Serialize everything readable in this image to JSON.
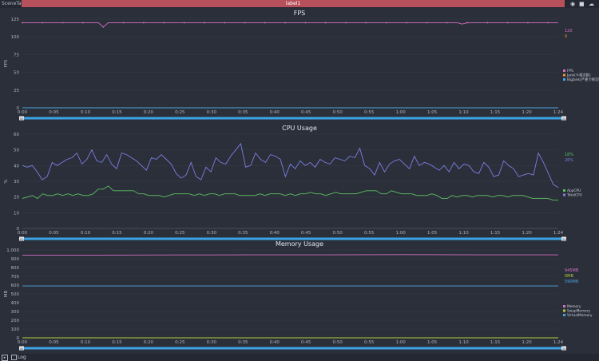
{
  "tab": {
    "scene": "SceneTab",
    "label": "label1"
  },
  "icons": [
    "location-icon",
    "folder-icon",
    "cloud-icon"
  ],
  "status": {
    "log_label": "Log"
  },
  "chart_data": [
    {
      "type": "line",
      "title": "FPS",
      "ylabel": "FPS",
      "ylim": [
        0,
        125
      ],
      "yticks": [
        "0",
        "25",
        "50",
        "75",
        "100",
        "125"
      ],
      "xticks": [
        "0:00",
        "0:05",
        "0:10",
        "0:15",
        "0:20",
        "0:25",
        "0:30",
        "0:35",
        "0:40",
        "0:45",
        "0:50",
        "0:55",
        "1:00",
        "1:05",
        "1:10",
        "1:15",
        "1:20",
        "1:24"
      ],
      "slider": {
        "start": "00",
        "end": "24"
      },
      "current": [
        {
          "text": "120",
          "color": "#d46fc6"
        },
        {
          "text": "0",
          "color": "#e9943a"
        }
      ],
      "series": [
        {
          "name": "FPS",
          "color": "#d46fc6",
          "markers": true,
          "values": [
            120,
            120,
            120,
            120,
            120,
            120,
            120,
            120,
            120,
            120,
            120,
            120,
            120,
            120,
            120,
            120,
            114,
            120,
            120,
            120,
            120,
            120,
            120,
            120,
            120,
            120,
            120,
            120,
            120,
            120,
            120,
            120,
            120,
            120,
            120,
            120,
            120,
            120,
            120,
            120,
            120,
            120,
            120,
            120,
            120,
            120,
            120,
            120,
            120,
            120,
            120,
            120,
            120,
            120,
            120,
            120,
            120,
            120,
            120,
            120,
            120,
            120,
            120,
            120,
            120,
            120,
            120,
            120,
            120,
            120,
            120,
            120,
            120,
            120,
            120,
            120,
            120,
            120,
            120,
            120,
            120,
            120,
            120,
            120,
            120,
            120,
            120,
            118,
            120,
            120,
            120,
            120,
            120,
            120,
            120,
            120,
            120,
            120,
            120,
            120,
            120,
            120,
            120,
            120,
            120,
            120,
            120
          ]
        },
        {
          "name": "Jank(卡顿次数)",
          "color": "#e9943a",
          "markers": false,
          "values": [
            0,
            0
          ]
        },
        {
          "name": "BigJank(严重卡顿次数)",
          "color": "#4aa3df",
          "markers": false,
          "values": [
            0,
            0
          ]
        }
      ]
    },
    {
      "type": "line",
      "title": "CPU Usage",
      "ylabel": "%",
      "ylim": [
        0,
        60
      ],
      "yticks": [
        "0",
        "10",
        "20",
        "30",
        "40",
        "50",
        "60"
      ],
      "xticks": [
        "0:00",
        "0:05",
        "0:10",
        "0:15",
        "0:20",
        "0:25",
        "0:30",
        "0:35",
        "0:40",
        "0:45",
        "0:50",
        "0:55",
        "1:00",
        "1:05",
        "1:10",
        "1:15",
        "1:20",
        "1:24"
      ],
      "slider": {
        "start": "00",
        "end": "24"
      },
      "current": [
        {
          "text": "18%",
          "color": "#5cbf60"
        },
        {
          "text": "26%",
          "color": "#7a7fe0"
        }
      ],
      "series": [
        {
          "name": "AppCPU",
          "color": "#5cbf60",
          "markers": false,
          "values": [
            19,
            20,
            21,
            19,
            22,
            21,
            21,
            22,
            21,
            22,
            21,
            22,
            21,
            21,
            22,
            25,
            25,
            27,
            24,
            24,
            24,
            24,
            24,
            22,
            22,
            21,
            21,
            21,
            20,
            21,
            22,
            22,
            22,
            22,
            21,
            22,
            21,
            22,
            22,
            21,
            22,
            22,
            22,
            21,
            21,
            21,
            21,
            22,
            21,
            22,
            22,
            22,
            21,
            22,
            21,
            22,
            22,
            23,
            22,
            22,
            21,
            22,
            23,
            22,
            22,
            22,
            22,
            23,
            24,
            24,
            24,
            22,
            22,
            24,
            23,
            22,
            22,
            22,
            21,
            21,
            21,
            22,
            21,
            19,
            19,
            21,
            20,
            21,
            21,
            20,
            21,
            21,
            21,
            20,
            21,
            21,
            20,
            21,
            21,
            21,
            20,
            19,
            19,
            19,
            19,
            18,
            18
          ]
        },
        {
          "name": "TotalCPU",
          "color": "#7a7fe0",
          "markers": false,
          "values": [
            40,
            39,
            40,
            36,
            31,
            33,
            42,
            40,
            42,
            44,
            45,
            48,
            41,
            44,
            50,
            43,
            42,
            47,
            41,
            38,
            48,
            47,
            45,
            43,
            40,
            37,
            45,
            44,
            47,
            44,
            41,
            35,
            32,
            34,
            42,
            33,
            31,
            39,
            36,
            45,
            42,
            41,
            46,
            50,
            54,
            39,
            40,
            48,
            44,
            42,
            47,
            46,
            44,
            33,
            41,
            38,
            43,
            40,
            42,
            39,
            44,
            42,
            41,
            45,
            44,
            43,
            46,
            45,
            51,
            40,
            38,
            34,
            42,
            36,
            41,
            43,
            44,
            41,
            38,
            46,
            40,
            42,
            41,
            39,
            37,
            40,
            36,
            42,
            38,
            41,
            40,
            36,
            35,
            42,
            39,
            33,
            34,
            43,
            40,
            38,
            33,
            34,
            35,
            34,
            48,
            42,
            35,
            28,
            26
          ]
        }
      ]
    },
    {
      "type": "line",
      "title": "Memory Usage",
      "ylabel": "MB",
      "ylim": [
        0,
        1000
      ],
      "yticks": [
        "0",
        "100",
        "200",
        "300",
        "400",
        "500",
        "600",
        "700",
        "800",
        "900",
        "1,000"
      ],
      "xticks": [
        "0:00",
        "0:05",
        "0:10",
        "0:15",
        "0:20",
        "0:25",
        "0:30",
        "0:35",
        "0:40",
        "0:45",
        "0:50",
        "0:55",
        "1:00",
        "1:05",
        "1:10",
        "1:15",
        "1:20",
        "1:24"
      ],
      "slider": {
        "start": "00",
        "end": "24"
      },
      "current": [
        {
          "text": "945MB",
          "color": "#d46fc6"
        },
        {
          "text": "0MB",
          "color": "#b5c93a"
        },
        {
          "text": "590MB",
          "color": "#4aa3df"
        }
      ],
      "series": [
        {
          "name": "Memory",
          "color": "#d46fc6",
          "markers": false,
          "values": [
            940,
            942,
            944,
            945,
            945,
            947,
            945,
            945
          ]
        },
        {
          "name": "SwapMemory",
          "color": "#b5c93a",
          "markers": false,
          "values": [
            0,
            0,
            0,
            0,
            0,
            0,
            0,
            0
          ]
        },
        {
          "name": "VirtualMemory",
          "color": "#4aa3df",
          "markers": false,
          "values": [
            590,
            590,
            590,
            590,
            590,
            590,
            590,
            590
          ]
        }
      ]
    }
  ]
}
